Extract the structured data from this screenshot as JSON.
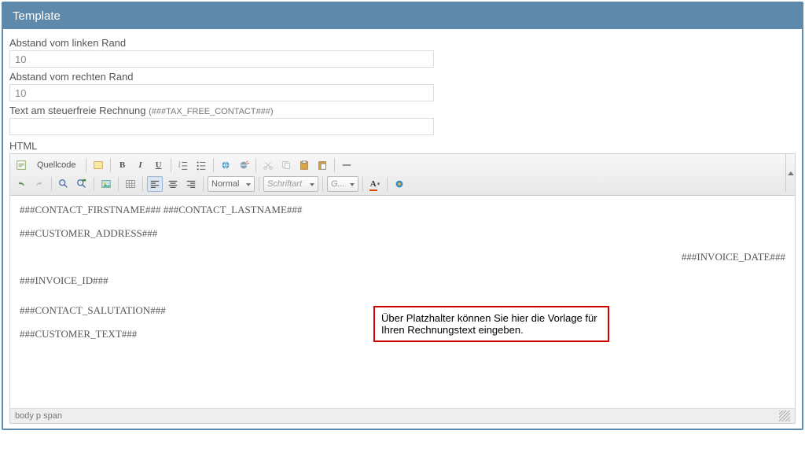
{
  "panel": {
    "title": "Template"
  },
  "form": {
    "left_margin_label": "Abstand vom linken Rand",
    "left_margin_value": "10",
    "right_margin_label": "Abstand vom rechten Rand",
    "right_margin_value": "10",
    "taxfree_label": "Text am steuerfreie Rechnung",
    "taxfree_hint": "(###TAX_FREE_CONTACT###)",
    "taxfree_value": "",
    "html_label": "HTML"
  },
  "toolbar": {
    "source": "Quellcode",
    "format_select": "Normal",
    "font_select": "Schriftart",
    "size_select": "G..."
  },
  "editor": {
    "line1": "###CONTACT_FIRSTNAME### ###CONTACT_LASTNAME###",
    "line2": "###CUSTOMER_ADDRESS###",
    "line3_right": "###INVOICE_DATE###",
    "line4": "###INVOICE_ID###",
    "line5": "###CONTACT_SALUTATION###",
    "line6": "###CUSTOMER_TEXT###"
  },
  "annotation": {
    "text": "Über Platzhalter können Sie hier die Vorlage für Ihren Rechnungstext eingeben."
  },
  "status": {
    "path": "body  p  span"
  }
}
